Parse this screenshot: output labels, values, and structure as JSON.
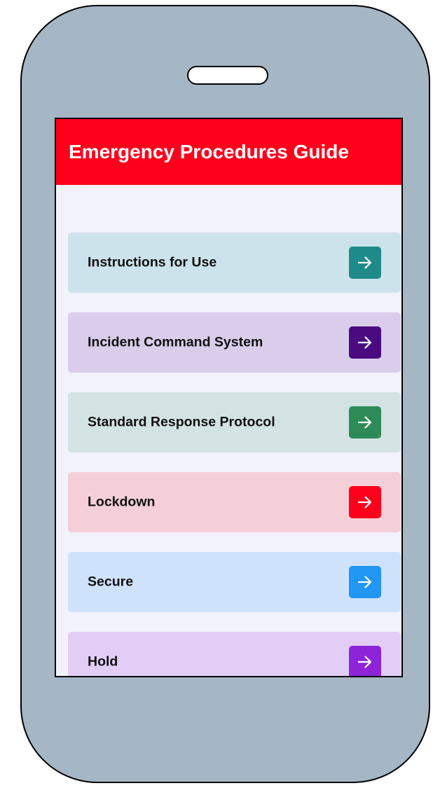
{
  "app": {
    "title": "Emergency Procedures Guide"
  },
  "menu": {
    "items": [
      {
        "label": "Instructions for Use",
        "bg": "#cde3ec",
        "accent": "#1f8a8a",
        "icon": "arrow-right-icon"
      },
      {
        "label": "Incident Command System",
        "bg": "#d9cdeb",
        "accent": "#4a0b80",
        "icon": "arrow-right-icon"
      },
      {
        "label": "Standard Response Protocol",
        "bg": "#d3e3e3",
        "accent": "#2e8b57",
        "icon": "arrow-right-icon"
      },
      {
        "label": "Lockdown",
        "bg": "#f4cfd8",
        "accent": "#ff001c",
        "icon": "arrow-right-icon"
      },
      {
        "label": "Secure",
        "bg": "#cfe2fb",
        "accent": "#2196f3",
        "icon": "arrow-right-icon"
      },
      {
        "label": "Hold",
        "bg": "#e2cdf6",
        "accent": "#8e24d8",
        "icon": "arrow-right-icon"
      }
    ]
  },
  "colors": {
    "header": "#ff001c",
    "device": "#a5b6c5",
    "screen": "#f2f2fc"
  }
}
